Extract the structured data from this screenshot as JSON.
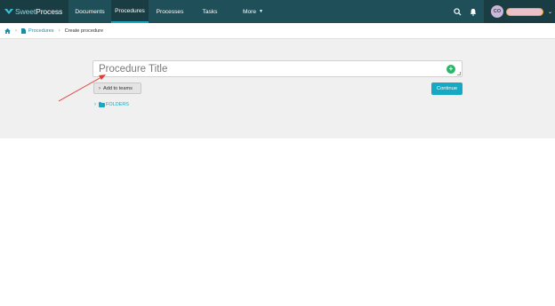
{
  "app": {
    "logo_text_light": "Sweet",
    "logo_text_bold": "Process",
    "colors": {
      "topbar": "#1f4f58",
      "accent": "#15a9c4",
      "plus": "#2db56b",
      "arrow": "#e03c31"
    }
  },
  "nav": {
    "items": [
      {
        "label": "Documents"
      },
      {
        "label": "Procedures"
      },
      {
        "label": "Processes"
      },
      {
        "label": "Tasks"
      },
      {
        "label": "More"
      }
    ],
    "active": "Procedures"
  },
  "user": {
    "initials": "CO"
  },
  "breadcrumb": {
    "home_icon": "home-icon",
    "procedures_label": "Procedures",
    "current_label": "Create procedure"
  },
  "form": {
    "title_placeholder": "Procedure Title",
    "add_to_teams_label": "Add to teams",
    "continue_label": "Continue",
    "folders_label": "FOLDERS"
  }
}
